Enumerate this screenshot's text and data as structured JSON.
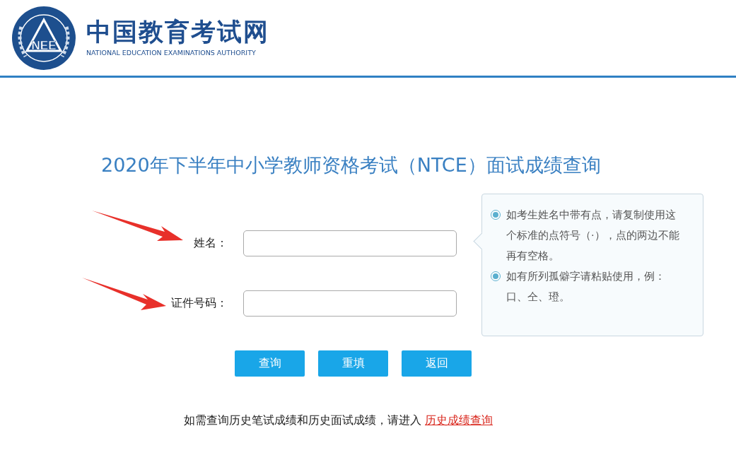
{
  "header": {
    "logo_mark": "NEE",
    "site_name": "中国教育考试网",
    "site_name_en": "NATIONAL EDUCATION EXAMINATIONS AUTHORITY"
  },
  "title": "2020年下半年中小学教师资格考试（NTCE）面试成绩查询",
  "fields": [
    {
      "label": "姓名："
    },
    {
      "label": "证件号码："
    }
  ],
  "tips": [
    "如考生姓名中带有点，请复制使用这个标准的点符号（·），点的两边不能再有空格。",
    "如有所列孤僻字请粘贴使用，例：口、仝、璒。"
  ],
  "buttons": [
    "查询",
    "重填",
    "返回"
  ],
  "footer_note": {
    "text": "如需查询历史笔试成绩和历史面试成绩，请进入",
    "link": "历史成绩查询"
  }
}
